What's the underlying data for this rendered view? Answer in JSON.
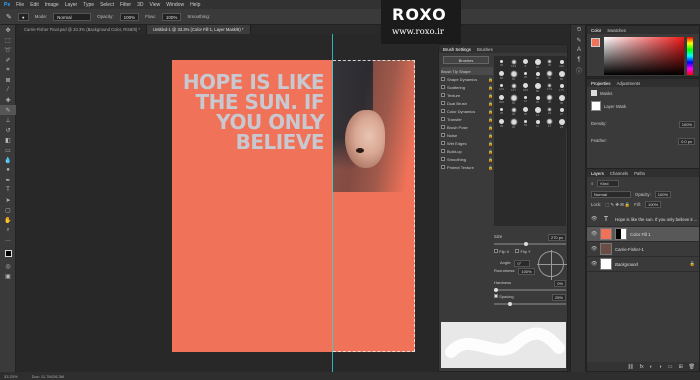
{
  "menu": [
    "File",
    "Edit",
    "Image",
    "Layer",
    "Type",
    "Select",
    "Filter",
    "3D",
    "View",
    "Window",
    "Help"
  ],
  "options": {
    "mode_label": "Mode:",
    "mode_value": "Normal",
    "opacity_label": "Opacity:",
    "opacity_value": "100%",
    "flow_label": "Flow:",
    "flow_value": "100%",
    "smoothing_label": "Smoothing:"
  },
  "doc_tabs": [
    {
      "label": "Carrie-Fisher Final.psd @ 33.3% (Background Color, RGB/8) *",
      "active": false
    },
    {
      "label": "Untitled-1 @ 33.3% (Color Fill 1, Layer Mask/8) *",
      "active": true
    }
  ],
  "canvas": {
    "quote": "HOPE IS LIKE THE SUN. IF YOU ONLY BELIEVE",
    "bg_color": "#f07258"
  },
  "watermark": {
    "logo": "ROXO",
    "url": "www.roxo.ir"
  },
  "brush_settings": {
    "tab_active": "Brush Settings",
    "tab_other": "Brushes",
    "brushes_button": "Brushes",
    "items": [
      "Brush Tip Shape",
      "Shape Dynamics",
      "Scattering",
      "Texture",
      "Dual Brush",
      "Color Dynamics",
      "Transfer",
      "Brush Pose",
      "Noise",
      "Wet Edges",
      "Build-up",
      "Smoothing",
      "Protect Texture"
    ],
    "size_label": "Size",
    "size_value": "270 px",
    "flip_x": "Flip X",
    "flip_y": "Flip Y",
    "angle_label": "Angle:",
    "angle_value": "0°",
    "roundness_label": "Roundness:",
    "roundness_value": "100%",
    "hardness_label": "Hardness",
    "hardness_value": "0%",
    "spacing_label": "Spacing",
    "spacing_value": "25%",
    "brush_sizes": [
      "30",
      "123",
      "8",
      "10",
      "25",
      "112",
      "60",
      "50",
      "25",
      "30",
      "50",
      "60",
      "100",
      "127",
      "284",
      "80",
      "174",
      "175",
      "306",
      "50",
      "16",
      "25",
      "36",
      "36",
      "36",
      "32",
      "25",
      "14",
      "24",
      "27",
      "39",
      "46",
      "59",
      "11",
      "17",
      "23"
    ]
  },
  "color_panel": {
    "tab1": "Color",
    "tab2": "Swatches"
  },
  "properties": {
    "tab1": "Properties",
    "tab2": "Adjustments",
    "masks_label": "Masks",
    "layer_mask_label": "Layer Mask",
    "density_label": "Density:",
    "density_value": "100%",
    "feather_label": "Feather:",
    "feather_value": "0.0 px"
  },
  "layers": {
    "tab1": "Layers",
    "tab2": "Channels",
    "tab3": "Paths",
    "kind_label": "Kind",
    "blend_value": "Normal",
    "opacity_label": "Opacity:",
    "opacity_value": "100%",
    "lock_label": "Lock:",
    "fill_label": "Fill:",
    "fill_value": "100%",
    "rows": [
      {
        "name": "Hope is like the sun. If you only believe it ...",
        "selected": false
      },
      {
        "name": "Color Fill 1",
        "selected": true
      },
      {
        "name": "Carrie-Fisher-1",
        "selected": false
      },
      {
        "name": "Background",
        "selected": false
      }
    ]
  },
  "status": {
    "zoom": "33.33%",
    "doc": "Doc: 11.7M/26.3M"
  }
}
